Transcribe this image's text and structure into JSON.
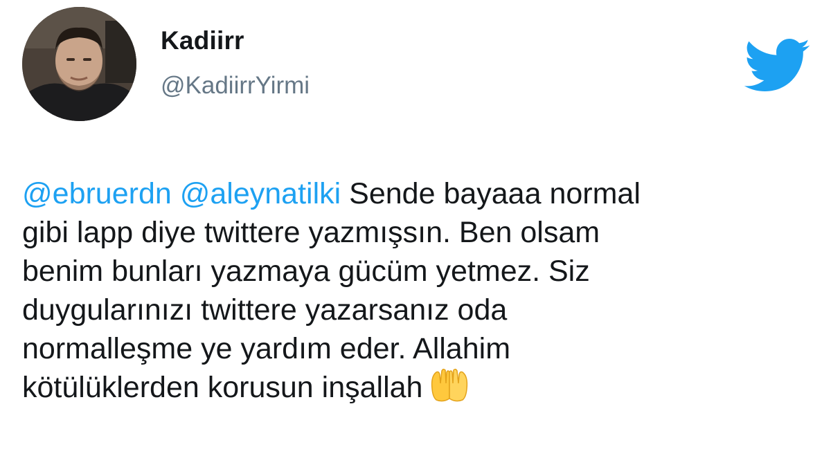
{
  "author": {
    "display_name": "Kadiirr",
    "handle": "@KadiirrYirmi",
    "avatar": "profile-photo"
  },
  "brand": {
    "icon": "twitter-bird-icon",
    "color": "#1da1f2"
  },
  "tweet": {
    "mention_1": "@ebruerdn",
    "mention_2": "@aleynatilki",
    "line_1_rest": "Sende bayaaa normal",
    "line_2": "gibi lapp diye twittere yazmışsın. Ben olsam",
    "line_3": "benim bunları yazmaya gücüm yetmez. Siz",
    "line_4": "duygularınızı twittere yazarsanız oda",
    "line_5": "normalleşme ye yardım eder. Allahim",
    "line_6": "kötülüklerden korusun inşallah",
    "emoji": "palms-up-together-emoji"
  },
  "colors": {
    "text": "#14171a",
    "secondary": "#657786",
    "link": "#1da1f2"
  }
}
